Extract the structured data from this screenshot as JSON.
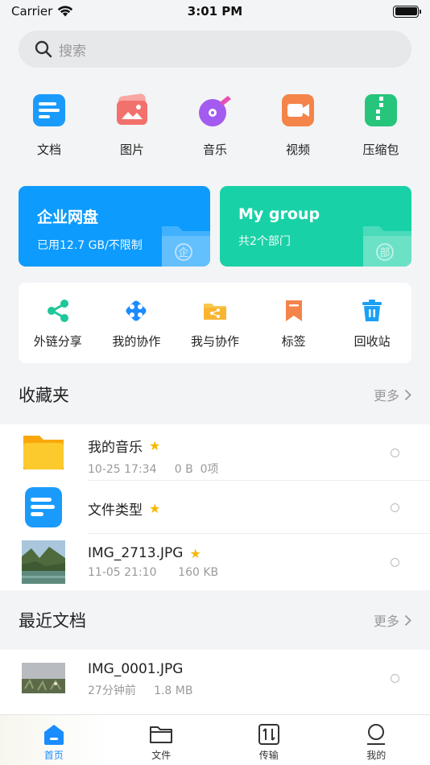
{
  "status": {
    "carrier": "Carrier",
    "time": "3:01 PM"
  },
  "search": {
    "placeholder": "搜索"
  },
  "categories": [
    {
      "label": "文档",
      "icon": "document-icon",
      "color": "#1a9bfc"
    },
    {
      "label": "图片",
      "icon": "image-icon",
      "color": "#f2716c"
    },
    {
      "label": "音乐",
      "icon": "music-icon",
      "color": "#a45bf0"
    },
    {
      "label": "视频",
      "icon": "video-icon",
      "color": "#f5844a"
    },
    {
      "label": "压缩包",
      "icon": "archive-icon",
      "color": "#27c47b"
    }
  ],
  "cards": [
    {
      "title": "企业网盘",
      "subtitle": "已用12.7 GB/不限制",
      "color": "#0d9bfd",
      "badge": "企"
    },
    {
      "title": "My group",
      "subtitle": "共2个部门",
      "color": "#19d1a7",
      "badge": "部"
    }
  ],
  "actions": [
    {
      "label": "外链分享",
      "icon": "share-icon",
      "color": "#1fc79a"
    },
    {
      "label": "我的协作",
      "icon": "collaboration-icon",
      "color": "#1a8cff"
    },
    {
      "label": "我与协作",
      "icon": "shared-folder-icon",
      "color": "#f9b532"
    },
    {
      "label": "标签",
      "icon": "bookmark-icon",
      "color": "#f5844a"
    },
    {
      "label": "回收站",
      "icon": "trash-icon",
      "color": "#1aa0f5"
    }
  ],
  "favorites": {
    "title": "收藏夹",
    "more": "更多",
    "items": [
      {
        "name": "我的音乐",
        "meta": "10-25 17:34     0 B  0项",
        "type": "folder"
      },
      {
        "name": "文件类型",
        "meta": "",
        "type": "doc"
      },
      {
        "name": "IMG_2713.JPG",
        "meta": "11-05 21:10      160 KB",
        "type": "photo-lake"
      }
    ]
  },
  "recent": {
    "title": "最近文档",
    "more": "更多",
    "items": [
      {
        "name": "IMG_0001.JPG",
        "meta": "27分钟前     1.8 MB",
        "type": "photo-field"
      }
    ]
  },
  "tabs": [
    {
      "label": "首页",
      "icon": "home-icon",
      "active": true
    },
    {
      "label": "文件",
      "icon": "folder-icon",
      "active": false
    },
    {
      "label": "传输",
      "icon": "transfer-icon",
      "active": false
    },
    {
      "label": "我的",
      "icon": "profile-icon",
      "active": false
    }
  ]
}
